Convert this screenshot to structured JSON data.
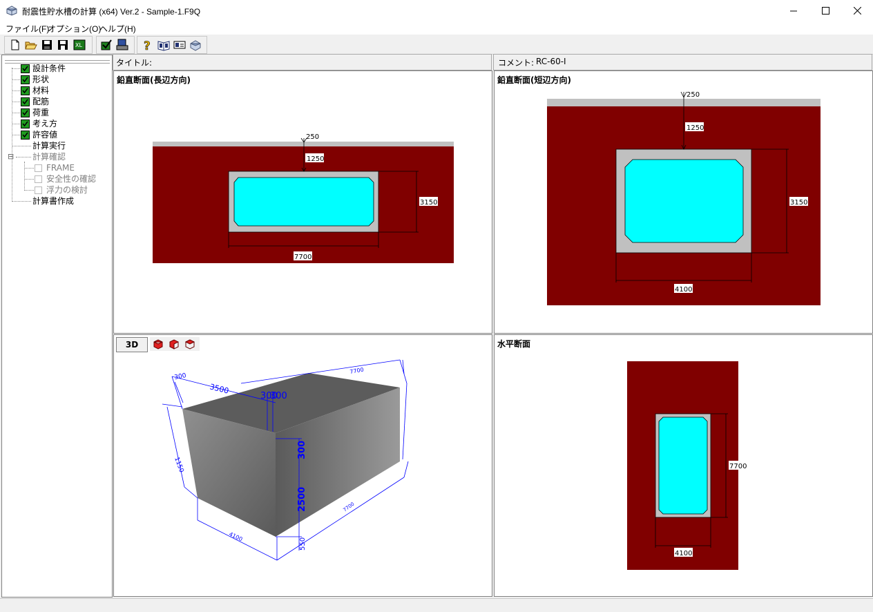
{
  "window": {
    "title": "耐震性貯水槽の計算 (x64) Ver.2 - Sample-1.F9Q",
    "minimize": "—",
    "maximize": "☐",
    "close": "✕"
  },
  "menu": [
    "ファイル(F)",
    "オプション(O)",
    "ヘルプ(H)"
  ],
  "toolbar": {
    "icons": [
      "new-file-icon",
      "open-folder-icon",
      "save-icon",
      "save-as-icon",
      "export-icon",
      "check-icon",
      "print-icon",
      "help-icon",
      "book-icon",
      "card-icon",
      "tank-icon"
    ]
  },
  "tree": {
    "items": [
      {
        "label": "設計条件",
        "checked": true
      },
      {
        "label": "形状",
        "checked": true
      },
      {
        "label": "材料",
        "checked": true
      },
      {
        "label": "配筋",
        "checked": true
      },
      {
        "label": "荷重",
        "checked": true
      },
      {
        "label": "考え方",
        "checked": true
      },
      {
        "label": "許容値",
        "checked": true
      },
      {
        "label": "計算実行"
      },
      {
        "label": "計算確認"
      },
      {
        "label": "FRAME"
      },
      {
        "label": "安全性の確認"
      },
      {
        "label": "浮力の検討"
      },
      {
        "label": "計算書作成"
      }
    ],
    "collapse_glyph": "⊟"
  },
  "header": {
    "title_label": "タイトル:",
    "comment_label": "コメント:",
    "comment_value": "RC-60-I"
  },
  "panes": {
    "long_section": {
      "title": "鉛直断面(長辺方向)",
      "dims": {
        "cover": "250",
        "depth": "1250",
        "height": "3150",
        "width": "7700"
      }
    },
    "short_section": {
      "title": "鉛直断面(短辺方向)",
      "dims": {
        "cover": "250",
        "depth": "1250",
        "height": "3150",
        "width": "4100"
      }
    },
    "view3d": {
      "button": "3D",
      "dims": [
        "300",
        "3500",
        "7700",
        "300",
        "300",
        "300",
        "1150",
        "2500",
        "550",
        "7700",
        "4100"
      ]
    },
    "horizontal": {
      "title": "水平断面",
      "dims": {
        "length": "7700",
        "width": "4100"
      }
    }
  },
  "colors": {
    "soil": "#800000",
    "concrete": "#c0c0c0",
    "water": "#00ffff",
    "dim_3d": "#0000ff",
    "check_green": "#1f9b1f"
  }
}
